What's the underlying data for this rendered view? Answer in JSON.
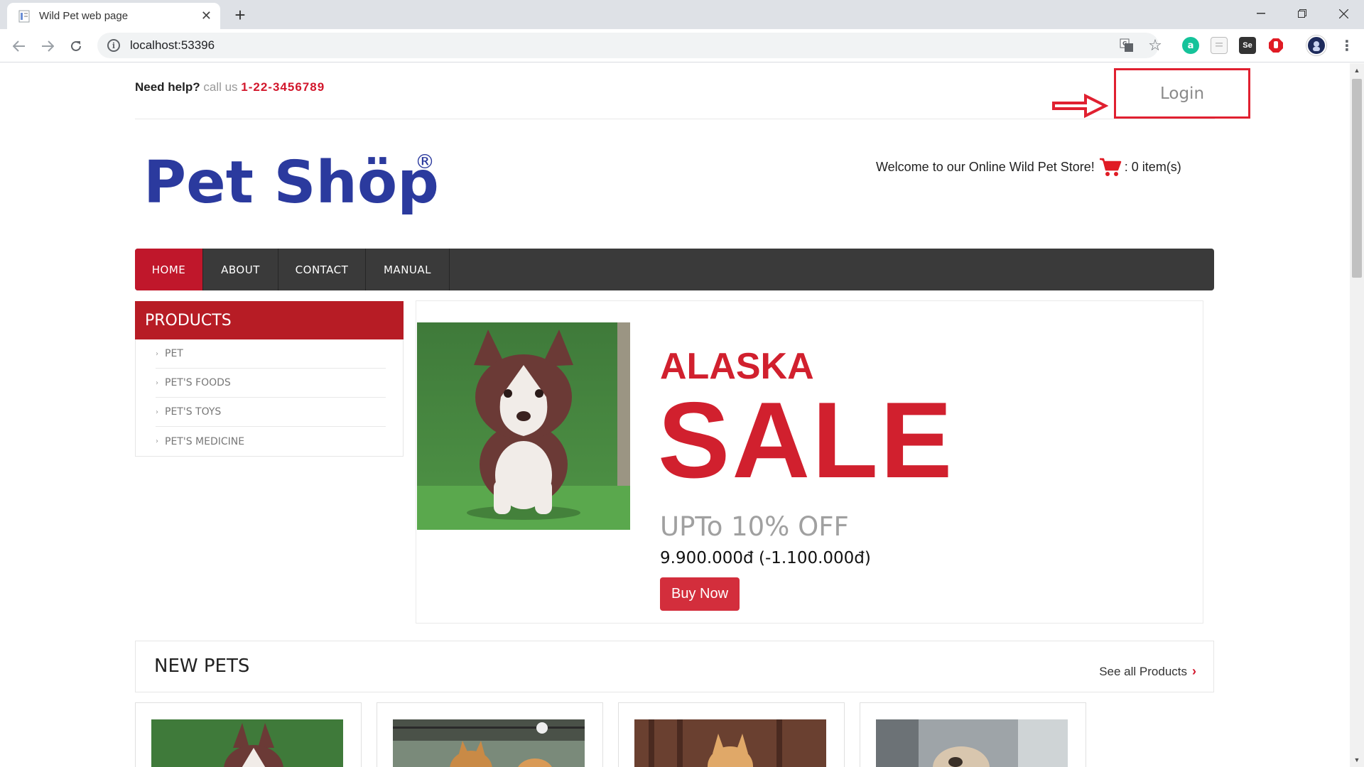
{
  "browser": {
    "tab_title": "Wild Pet web page",
    "url": "localhost:53396",
    "new_tab_label": "+",
    "icons": [
      "page-favicon",
      "close-icon",
      "back-icon",
      "forward-icon",
      "reload-icon",
      "info-icon",
      "translate-icon",
      "star-icon",
      "grammarly-icon",
      "reader-icon",
      "selenium-icon",
      "adblock-icon",
      "profile-avatar",
      "menu-icon",
      "minimize-icon",
      "restore-icon",
      "close-window-icon"
    ],
    "ext_labels": {
      "grammarly": "a",
      "selenium": "Se"
    }
  },
  "topbar": {
    "help_bold": "Need help?",
    "help_text": "call us",
    "phone": "1-22-3456789",
    "login_label": "Login"
  },
  "header": {
    "logo_text": "Pet Shöp",
    "logo_mark": "®",
    "welcome_text": "Welcome to our Online Wild Pet Store!",
    "cart_text": ": 0 item(s)"
  },
  "nav": {
    "items": [
      {
        "label": "HOME",
        "active": true
      },
      {
        "label": "ABOUT"
      },
      {
        "label": "CONTACT"
      },
      {
        "label": "MANUAL"
      }
    ]
  },
  "products": {
    "heading": "PRODUCTS",
    "items": [
      "PET",
      "PET'S FOODS",
      "PET'S TOYS",
      "PET'S MEDICINE"
    ]
  },
  "banner": {
    "line1": "ALASKA",
    "line2": "SALE",
    "line3": "UPTo 10% OFF",
    "price": "9.900.000đ (-1.100.000đ)",
    "button": "Buy Now"
  },
  "new_pets": {
    "title": "NEW PETS",
    "see_all": "See all Products"
  },
  "colors": {
    "accent": "#c0172b",
    "nav_bg": "#3a3a3a",
    "logo_blue": "#2b3a9e",
    "annotation": "#e02030"
  }
}
